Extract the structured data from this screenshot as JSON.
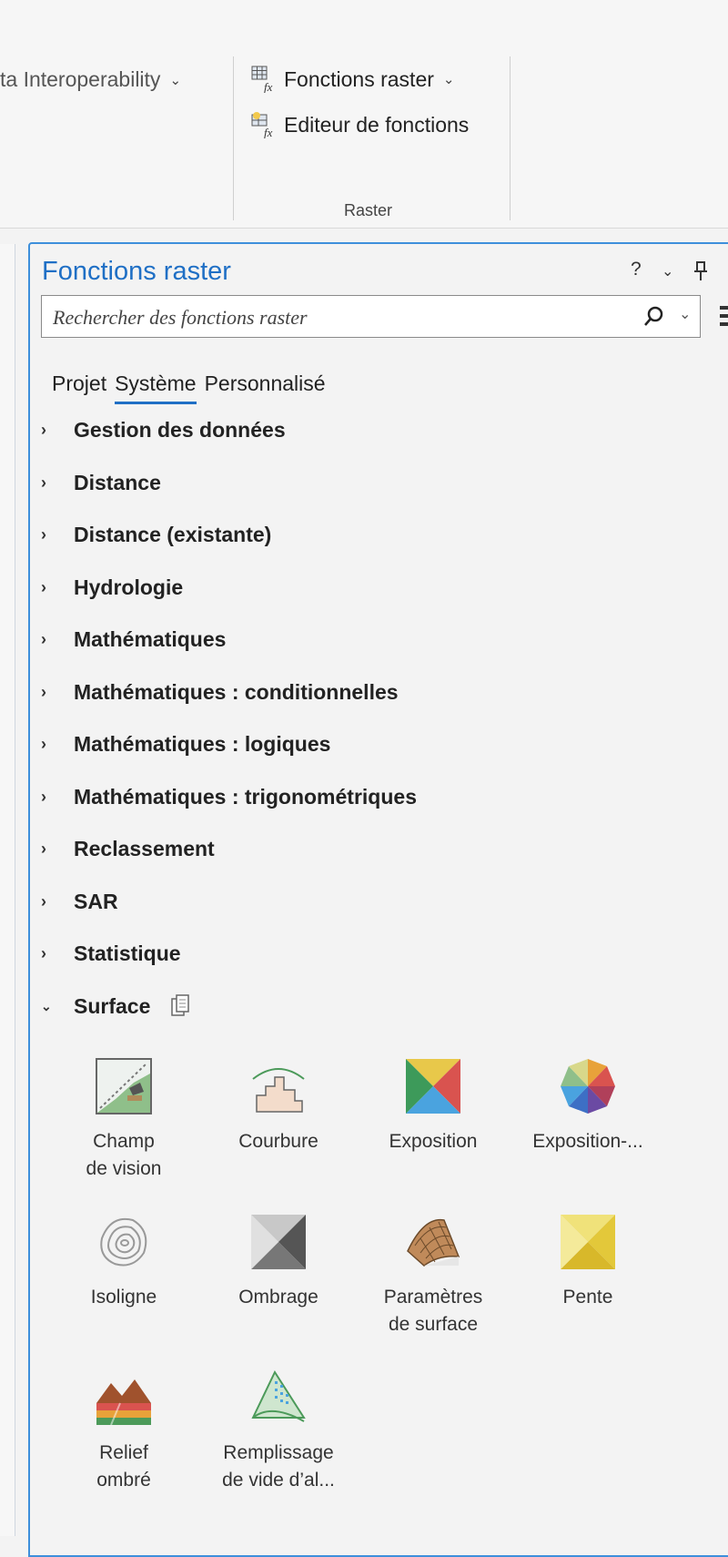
{
  "ribbon": {
    "data_interop": "ta Interoperability",
    "fonctions_raster": "Fonctions raster",
    "editeur_fonctions": "Editeur de fonctions",
    "group_label": "Raster"
  },
  "panel": {
    "title": "Fonctions raster",
    "help": "?",
    "search_placeholder": "Rechercher des fonctions raster",
    "tabs": [
      "Projet",
      "Système",
      "Personnalisé"
    ],
    "active_tab": "Système",
    "categories": [
      "Gestion des données",
      "Distance",
      "Distance (existante)",
      "Hydrologie",
      "Mathématiques",
      "Mathématiques : conditionnelles",
      "Mathématiques : logiques",
      "Mathématiques : trigonométriques",
      "Reclassement",
      "SAR",
      "Statistique",
      "Surface"
    ],
    "expanded_category": "Surface",
    "tools": [
      {
        "label": "Champ de vision",
        "line1": "Champ",
        "line2": "de vision",
        "icon": "viewshed-icon"
      },
      {
        "label": "Courbure",
        "line1": "Courbure",
        "line2": "",
        "icon": "curvature-icon"
      },
      {
        "label": "Exposition",
        "line1": "Exposition",
        "line2": "",
        "icon": "aspect-icon"
      },
      {
        "label": "Exposition-...",
        "line1": "Exposition-...",
        "line2": "",
        "icon": "aspect-slope-icon"
      },
      {
        "label": "Isoligne",
        "line1": "Isoligne",
        "line2": "",
        "icon": "contour-icon"
      },
      {
        "label": "Ombrage",
        "line1": "Ombrage",
        "line2": "",
        "icon": "hillshade-icon"
      },
      {
        "label": "Paramètres de surface",
        "line1": "Paramètres",
        "line2": "de surface",
        "icon": "surface-parameters-icon"
      },
      {
        "label": "Pente",
        "line1": "Pente",
        "line2": "",
        "icon": "slope-icon"
      },
      {
        "label": "Relief ombré",
        "line1": "Relief",
        "line2": "ombré",
        "icon": "shaded-relief-icon"
      },
      {
        "label": "Remplissage de vide d'al...",
        "line1": "Remplissage",
        "line2": "de vide d’al...",
        "icon": "void-fill-icon"
      }
    ]
  }
}
